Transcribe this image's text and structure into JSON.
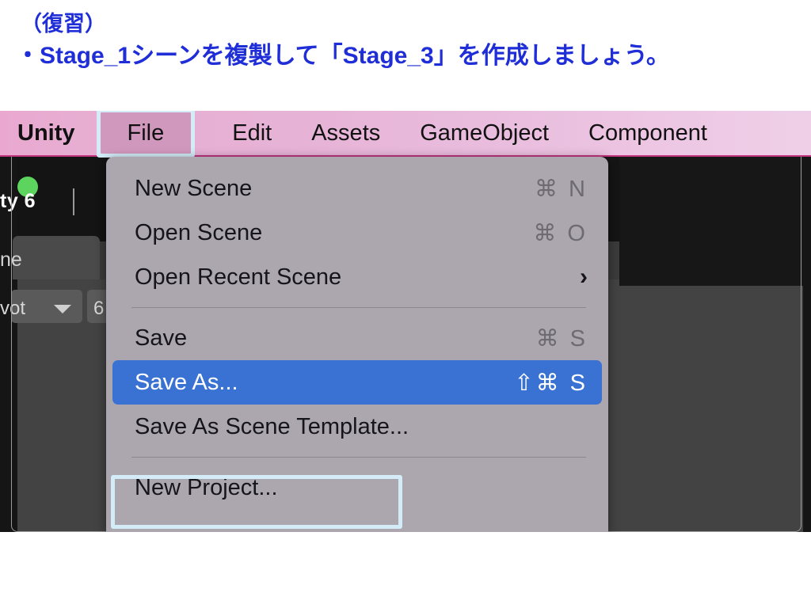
{
  "instructions": {
    "line1": "（復習）",
    "line2": "・Stage_1シーンを複製して「Stage_3」を作成しましょう。",
    "color": "#1f2ed6"
  },
  "editor": {
    "version_label": "ty 6",
    "scene_tab_label": "ne",
    "pivot_label": "vot",
    "next_chip_label": "6",
    "status_dot_color": "#5dd45d"
  },
  "menubar": {
    "highlight_color": "#d3ecf8",
    "tint_color": "#e7aed2",
    "items": [
      {
        "label": "Unity"
      },
      {
        "label": "File"
      },
      {
        "label": "Edit"
      },
      {
        "label": "Assets"
      },
      {
        "label": "GameObject"
      },
      {
        "label": "Component"
      }
    ]
  },
  "dropdown": {
    "selected_color": "#3a72d4",
    "background": "#aca7ae",
    "items": [
      {
        "label": "New Scene",
        "shortcut": "⌘ N",
        "selected": false
      },
      {
        "label": "Open Scene",
        "shortcut": "⌘ O",
        "selected": false
      },
      {
        "label": "Open Recent Scene",
        "shortcut": "",
        "submenu": "›",
        "selected": false
      },
      {
        "label": "Save",
        "shortcut": "⌘ S",
        "selected": false
      },
      {
        "label": "Save As...",
        "shortcut": "⇧⌘ S",
        "selected": true
      },
      {
        "label": "Save As Scene Template...",
        "shortcut": "",
        "selected": false
      },
      {
        "label": "New Project...",
        "shortcut": "",
        "selected": false
      }
    ]
  }
}
